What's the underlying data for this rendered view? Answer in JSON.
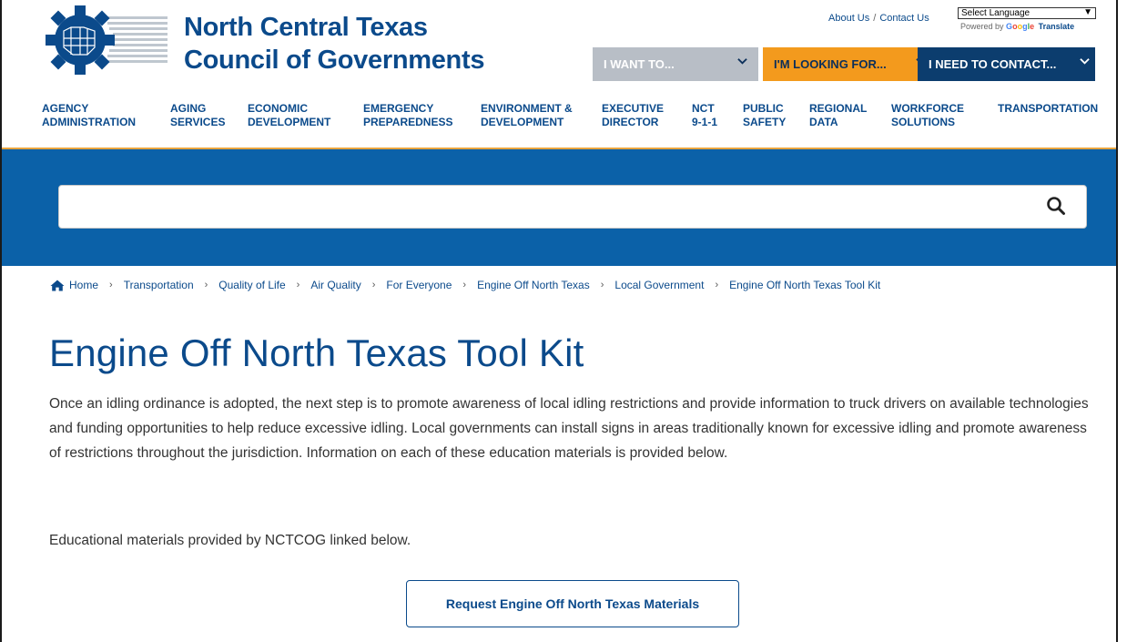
{
  "header": {
    "org_name_line1": "North Central Texas",
    "org_name_line2": "Council of Governments",
    "util_links": {
      "about": "About Us",
      "separator": "/",
      "contact": "Contact Us"
    },
    "language_select": {
      "selected": "Select Language",
      "powered_by": "Powered by",
      "google": "Google",
      "translate": "Translate"
    },
    "actions": [
      {
        "label": "I WANT TO..."
      },
      {
        "label": "I'M LOOKING FOR..."
      },
      {
        "label": "I NEED TO CONTACT..."
      }
    ]
  },
  "nav": [
    {
      "line1": "AGENCY",
      "line2": "ADMINISTRATION"
    },
    {
      "line1": "AGING",
      "line2": "SERVICES"
    },
    {
      "line1": "ECONOMIC",
      "line2": "DEVELOPMENT"
    },
    {
      "line1": "EMERGENCY",
      "line2": "PREPAREDNESS"
    },
    {
      "line1": "ENVIRONMENT &",
      "line2": "DEVELOPMENT"
    },
    {
      "line1": "EXECUTIVE",
      "line2": "DIRECTOR"
    },
    {
      "line1": "NCT",
      "line2": "9-1-1"
    },
    {
      "line1": "PUBLIC",
      "line2": "SAFETY"
    },
    {
      "line1": "REGIONAL",
      "line2": "DATA"
    },
    {
      "line1": "WORKFORCE",
      "line2": "SOLUTIONS"
    },
    {
      "line1": "TRANSPORTATION",
      "line2": ""
    }
  ],
  "search": {
    "value": "",
    "placeholder": ""
  },
  "breadcrumb": [
    "Home",
    "Transportation",
    "Quality of Life",
    "Air Quality",
    "For Everyone",
    "Engine Off North Texas",
    "Local Government",
    "Engine Off North Texas Tool Kit"
  ],
  "breadcrumb_sep": "›",
  "page": {
    "title": "Engine Off North Texas Tool Kit",
    "intro": "Once an idling ordinance is adopted, the next step is to promote awareness of local idling restrictions and provide information to truck drivers on available technologies and funding opportunities to help reduce excessive idling.  Local governments can install signs in areas traditionally known for excessive idling and promote awareness of restrictions throughout the jurisdiction.  Information on each of these education materials is provided below.",
    "note": "Educational materials provided by NCTCOG linked below.",
    "cta_label": "Request Engine Off North Texas Materials"
  },
  "colors": {
    "brand_blue": "#0b4a8b",
    "band_blue": "#0b61a8",
    "orange": "#f39a1d",
    "navy": "#0c3d6e",
    "gray": "#b8bec6"
  },
  "icons": {
    "logo": "nctcog-logo-icon",
    "search": "search-icon",
    "home": "home-icon",
    "chevron": "chevron-down-icon"
  }
}
